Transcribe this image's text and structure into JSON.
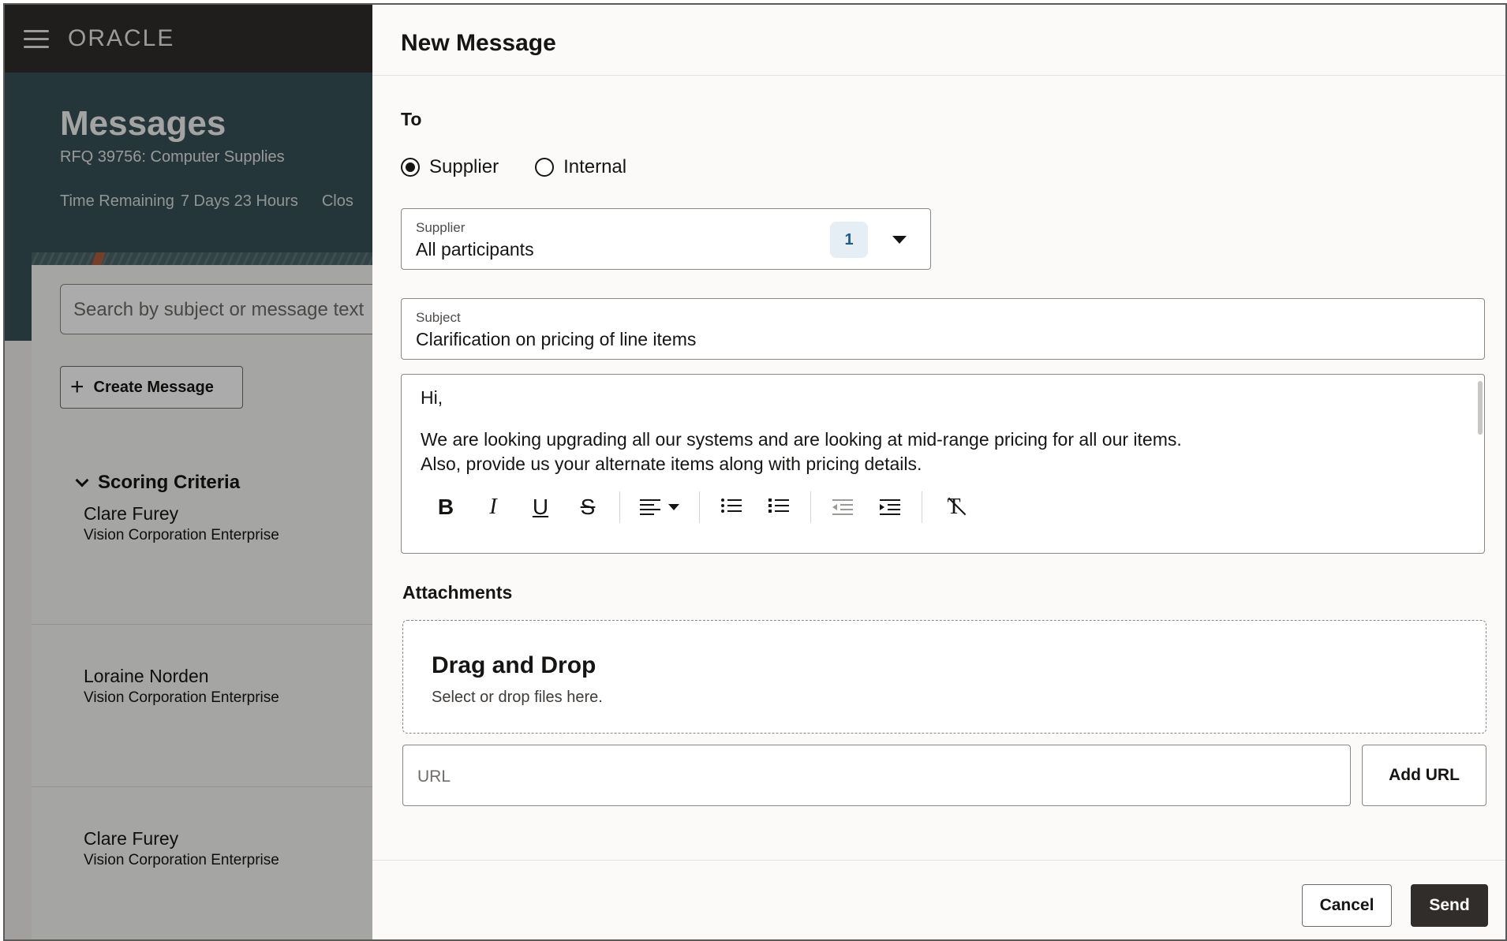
{
  "app": {
    "logo": "ORACLE"
  },
  "page": {
    "title": "Messages",
    "subtitle": "RFQ 39756: Computer Supplies",
    "time_remaining_label": "Time Remaining",
    "time_remaining_value": "7 Days 23 Hours",
    "close_label_partial": "Clos"
  },
  "search": {
    "placeholder": "Search by subject or message text"
  },
  "create_message_label": "Create Message",
  "section": {
    "title": "Scoring Criteria"
  },
  "messages": [
    {
      "name": "Clare Furey",
      "org": "Vision Corporation Enterprise"
    },
    {
      "name": "Loraine Norden",
      "org": "Vision Corporation Enterprise"
    },
    {
      "name": "Clare Furey",
      "org": "Vision Corporation Enterprise"
    }
  ],
  "drawer": {
    "title": "New Message",
    "to_label": "To",
    "recipient_options": [
      {
        "label": "Supplier",
        "selected": true
      },
      {
        "label": "Internal",
        "selected": false
      }
    ],
    "supplier_field": {
      "label": "Supplier",
      "value": "All participants",
      "count": "1"
    },
    "subject_field": {
      "label": "Subject",
      "value": "Clarification on pricing of line items"
    },
    "body": {
      "line1": "Hi,",
      "line2": "We are looking upgrading all our systems and are looking at mid-range pricing for all our items.",
      "line3": "Also, provide us your alternate items along with pricing details."
    },
    "toolbar": {
      "bold": "B",
      "italic": "I",
      "underline": "U",
      "strikethrough": "S",
      "clear_format": "T"
    },
    "attachments": {
      "label": "Attachments",
      "drop_title": "Drag and Drop",
      "drop_sub": "Select or drop files here.",
      "url_placeholder": "URL",
      "add_url_label": "Add URL"
    },
    "footer": {
      "cancel_label": "Cancel",
      "send_label": "Send"
    }
  },
  "colors": {
    "header_bg": "#312d2a",
    "hero_bg": "#385158",
    "primary_button": "#312d2a",
    "badge_text": "#1c5c8a"
  }
}
